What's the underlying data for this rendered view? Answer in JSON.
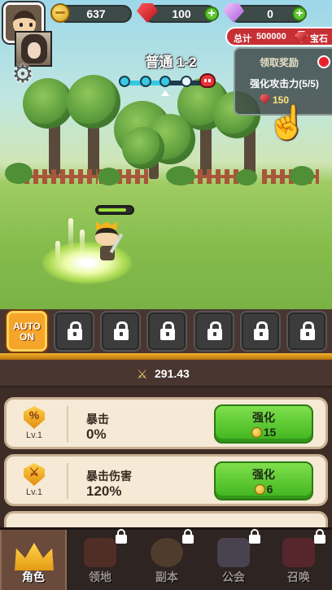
{
  "resources": {
    "gold": "637",
    "rubies": "100",
    "diamonds": "0",
    "add_symbol": "+"
  },
  "stage": {
    "title": "普通 1-2",
    "progress": 0.5
  },
  "reward": {
    "total_label": "总计",
    "total_value": "500000",
    "total_currency": "宝石",
    "claim_label": "领取奖励",
    "quest": "强化攻击力(5/5)",
    "amount": "150"
  },
  "hero": {
    "hp": 0.85
  },
  "skills": {
    "auto_label": "AUTO",
    "auto_state": "ON",
    "locked_slots": 6
  },
  "power": {
    "value": "291.43"
  },
  "upgrades": [
    {
      "name": "暴击",
      "value": "0%",
      "level": "Lv.1",
      "icon": "percent-shield-icon",
      "glyph": "%",
      "button": "强化",
      "cost": "15"
    },
    {
      "name": "暴击伤害",
      "value": "120%",
      "level": "Lv.1",
      "icon": "sword-shield-icon",
      "glyph": "⚔",
      "button": "强化",
      "cost": "6"
    }
  ],
  "nav": [
    {
      "label": "角色",
      "icon": "crown-icon",
      "active": true,
      "locked": false
    },
    {
      "label": "领地",
      "icon": "territory-icon",
      "active": false,
      "locked": true
    },
    {
      "label": "副本",
      "icon": "dungeon-icon",
      "active": false,
      "locked": true
    },
    {
      "label": "公会",
      "icon": "guild-icon",
      "active": false,
      "locked": true
    },
    {
      "label": "召唤",
      "icon": "summon-icon",
      "active": false,
      "locked": true
    }
  ],
  "colors": {
    "accent_gold": "#f2b32a",
    "button_green": "#3fb31d",
    "ruby_red": "#c62f34",
    "progress_cyan": "#36c9e6"
  }
}
